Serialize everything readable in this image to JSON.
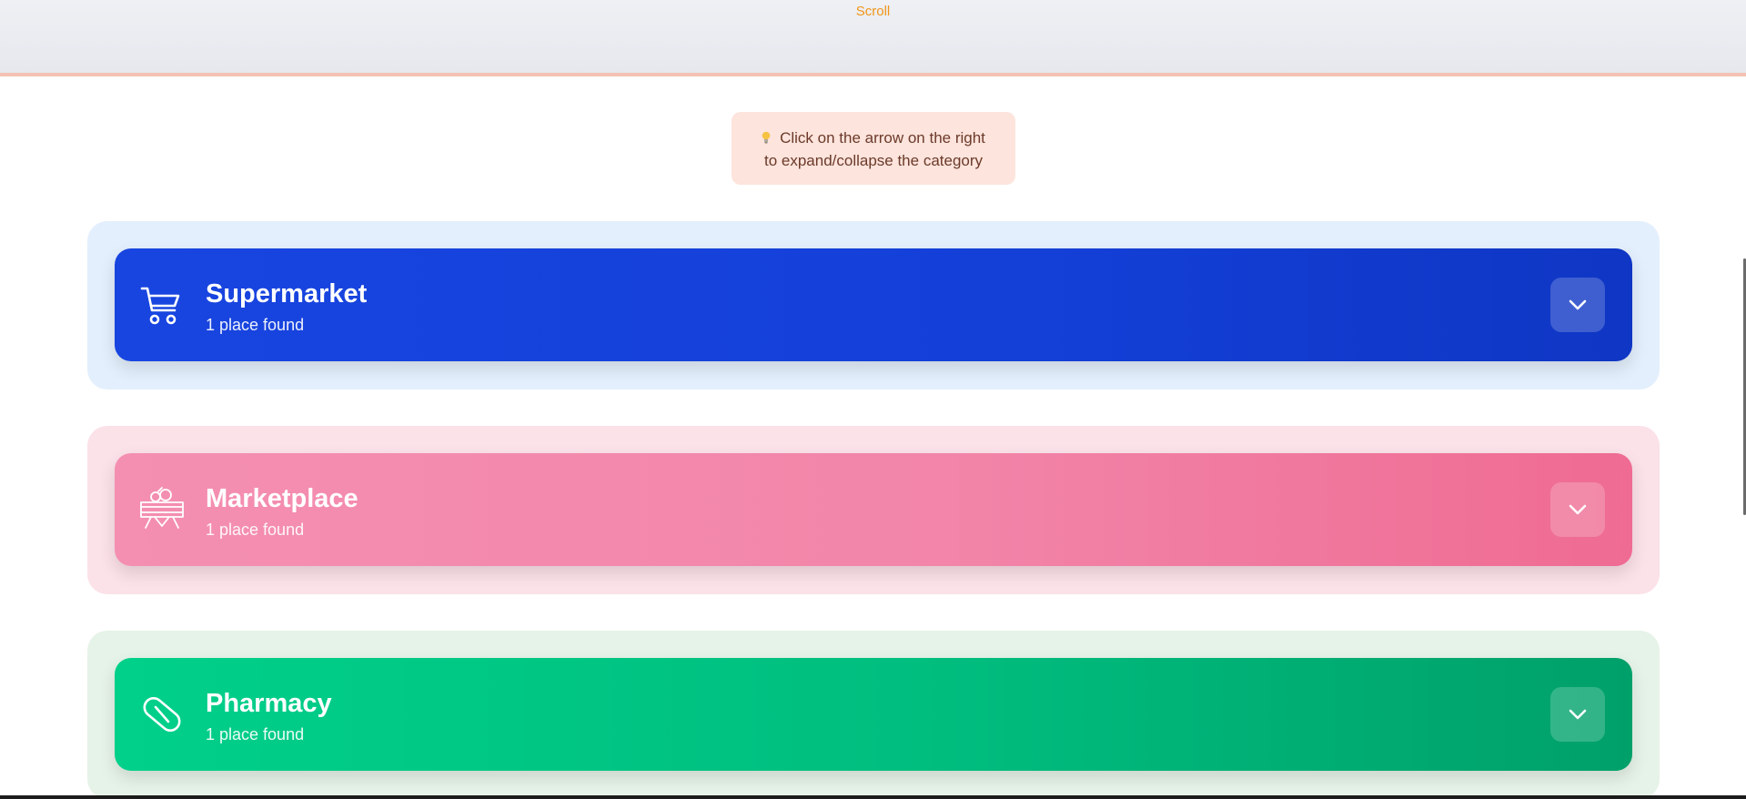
{
  "top_banner": {
    "scroll_label": "Scroll"
  },
  "hint": {
    "line1": "Click on the arrow on the right",
    "line2": "to expand/collapse the category",
    "icon": "lightbulb-icon"
  },
  "categories": [
    {
      "title": "Supermarket",
      "subtitle": "1 place found",
      "icon": "shopping-cart-icon",
      "wrap_color": "#e3effc",
      "gradient_from": "#1845e0",
      "gradient_to": "#0f36c4"
    },
    {
      "title": "Marketplace",
      "subtitle": "1 place found",
      "icon": "market-stall-icon",
      "wrap_color": "#fbe1e8",
      "gradient_from": "#f48fb1",
      "gradient_to": "#ef6b93"
    },
    {
      "title": "Pharmacy",
      "subtitle": "1 place found",
      "icon": "pill-icon",
      "wrap_color": "#e6f3e8",
      "gradient_from": "#00d08a",
      "gradient_to": "#00a06a"
    }
  ]
}
